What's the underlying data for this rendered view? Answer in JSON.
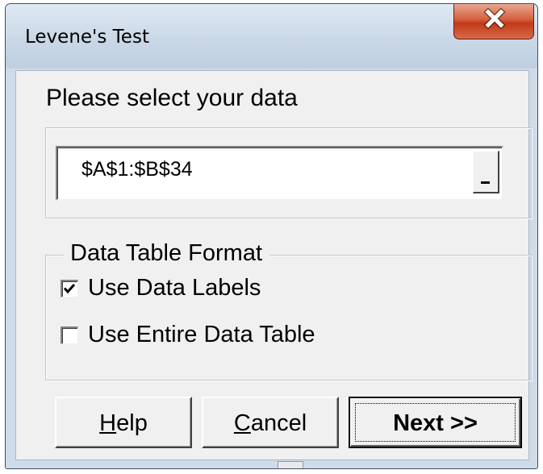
{
  "window": {
    "title": "Levene's Test",
    "close_icon": "close-icon"
  },
  "prompt": {
    "heading": "Please select your data"
  },
  "range": {
    "value": "$A$1:$B$34",
    "button_icon": "range-collapse-icon"
  },
  "format_group": {
    "legend": "Data Table Format",
    "options": [
      {
        "label": "Use Data Labels",
        "checked": true
      },
      {
        "label": "Use Entire Data Table",
        "checked": false
      }
    ]
  },
  "buttons": {
    "help": {
      "mnemonic": "H",
      "rest": "elp"
    },
    "cancel": {
      "mnemonic": "C",
      "rest": "ancel"
    },
    "next": {
      "label": "Next >>"
    }
  },
  "colors": {
    "dialog_face": "#f0f0f0",
    "frame": "#cfdbe8",
    "close_button": "#c13a18"
  }
}
